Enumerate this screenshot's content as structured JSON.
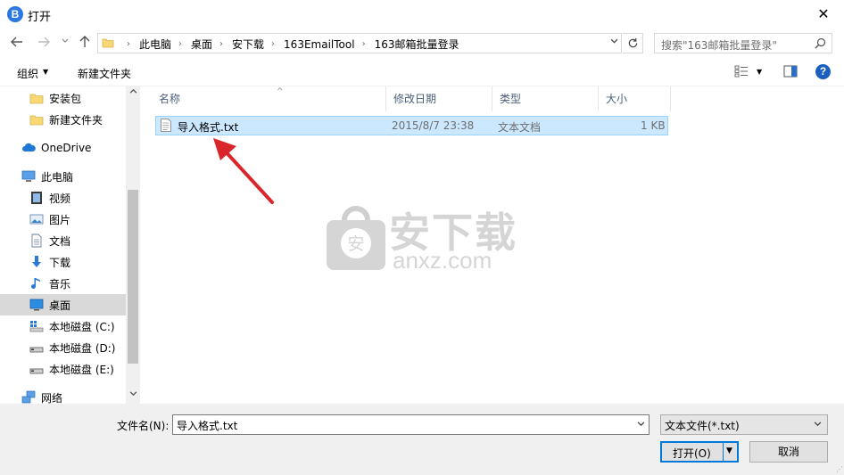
{
  "window": {
    "title": "打开",
    "app_icon_letter": "B",
    "close_glyph": "✕"
  },
  "navigation": {
    "back_icon": "arrow-left-icon",
    "forward_icon": "arrow-right-icon",
    "up_icon": "arrow-up-icon",
    "breadcrumbs": [
      "此电脑",
      "桌面",
      "安下载",
      "163EmailTool",
      "163邮箱批量登录"
    ],
    "search_placeholder": "搜索\"163邮箱批量登录\""
  },
  "toolbar": {
    "organize_label": "组织",
    "new_folder_label": "新建文件夹"
  },
  "sidebar": {
    "items": [
      {
        "label": "安装包",
        "icon": "folder-icon"
      },
      {
        "label": "新建文件夹",
        "icon": "folder-icon"
      },
      {
        "label": "OneDrive",
        "icon": "cloud-icon"
      },
      {
        "label": "此电脑",
        "icon": "computer-icon"
      },
      {
        "label": "视频",
        "icon": "video-icon"
      },
      {
        "label": "图片",
        "icon": "picture-icon"
      },
      {
        "label": "文档",
        "icon": "document-icon"
      },
      {
        "label": "下载",
        "icon": "download-icon"
      },
      {
        "label": "音乐",
        "icon": "music-icon"
      },
      {
        "label": "桌面",
        "icon": "desktop-icon",
        "selected": true
      },
      {
        "label": "本地磁盘 (C:)",
        "icon": "drive-c-icon"
      },
      {
        "label": "本地磁盘 (D:)",
        "icon": "drive-icon"
      },
      {
        "label": "本地磁盘 (E:)",
        "icon": "drive-icon"
      },
      {
        "label": "网络",
        "icon": "network-icon"
      }
    ]
  },
  "file_list": {
    "columns": [
      "名称",
      "修改日期",
      "类型",
      "大小"
    ],
    "rows": [
      {
        "name": "导入格式.txt",
        "modified": "2015/8/7 23:38",
        "type": "文本文档",
        "size": "1 KB",
        "selected": true
      }
    ]
  },
  "watermark": {
    "text": "安下载",
    "url": "anxz.com",
    "badge_char": "安"
  },
  "footer": {
    "filename_label": "文件名(N):",
    "filename_value": "导入格式.txt",
    "filetype_value": "文本文件(*.txt)",
    "open_label": "打开(O)",
    "cancel_label": "取消"
  },
  "colors": {
    "selection_bg": "#cce8ff",
    "selection_border": "#99d1ff",
    "accent": "#0078d7",
    "annotation_arrow": "#d9262b"
  }
}
